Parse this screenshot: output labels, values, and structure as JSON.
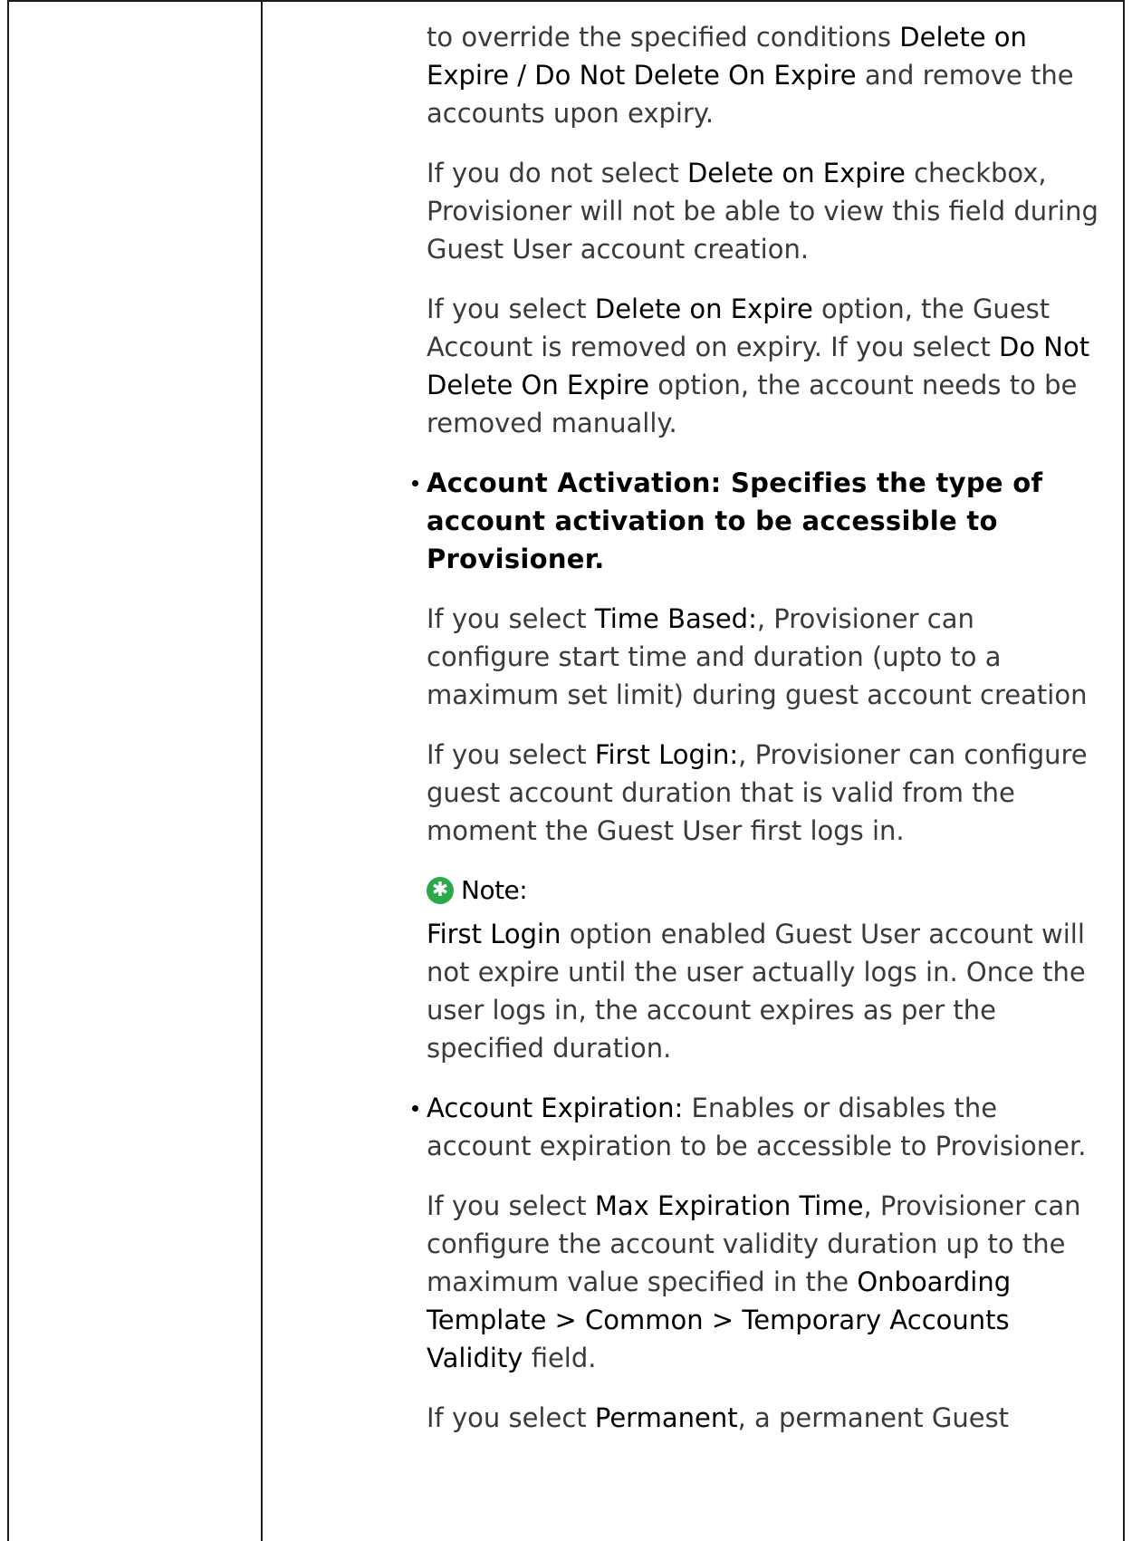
{
  "p1": {
    "t1": "to override the specified conditions ",
    "h1": "Delete on Expire / Do Not Delete On Expire",
    "t2": " and remove the accounts upon expiry."
  },
  "p2": {
    "t1": "If you do not select ",
    "h1": "Delete on Expire",
    "t2": " checkbox, Provisioner will not be able to view this field during Guest User account creation."
  },
  "p3": {
    "t1": "If you select ",
    "h1": "Delete on Expire",
    "t2": " option, the Guest Account is removed on expiry. If you select ",
    "h2": "Do Not Delete On Expire",
    "t3": " option, the account needs to be removed manually."
  },
  "bullet1": {
    "label": "Account Activation:",
    "text": " Specifies the type of account activation to be accessible to Provisioner."
  },
  "p4": {
    "t1": "If you select ",
    "h1": "Time Based:",
    "t2": ", Provisioner can configure start time and duration (upto to a maximum set limit) during guest account creation"
  },
  "p5": {
    "t1": "If you select ",
    "h1": "First Login:",
    "t2": ", Provisioner can configure guest account duration that is valid from the moment the Guest User first logs in."
  },
  "note": {
    "label": "Note:",
    "h1": " First Login",
    "t1": " option enabled Guest User account will not expire until the user actually logs in. Once the user logs in, the account expires as per the specified duration."
  },
  "bullet2": {
    "label": "Account Expiration:",
    "text": " Enables or disables the account expiration to be accessible to Provisioner."
  },
  "p6": {
    "t1": "If you select ",
    "h1": "Max Expiration Time",
    "t2": ", Provisioner can configure the account validity duration up to the maximum value specified in the ",
    "h2": "Onboarding Template >  Common > Temporary Accounts Validity",
    "t3": " field."
  },
  "p7": {
    "t1": "If you select ",
    "h1": "Permanent",
    "t2": ", a permanent Guest"
  }
}
